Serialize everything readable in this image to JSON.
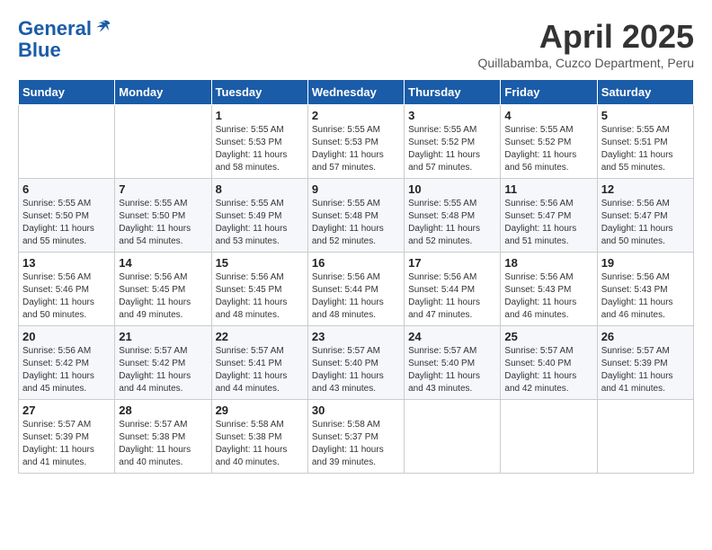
{
  "header": {
    "logo_line1": "General",
    "logo_line2": "Blue",
    "month_title": "April 2025",
    "location": "Quillabamba, Cuzco Department, Peru"
  },
  "days_of_week": [
    "Sunday",
    "Monday",
    "Tuesday",
    "Wednesday",
    "Thursday",
    "Friday",
    "Saturday"
  ],
  "weeks": [
    [
      {
        "day": "",
        "info": ""
      },
      {
        "day": "",
        "info": ""
      },
      {
        "day": "1",
        "info": "Sunrise: 5:55 AM\nSunset: 5:53 PM\nDaylight: 11 hours and 58 minutes."
      },
      {
        "day": "2",
        "info": "Sunrise: 5:55 AM\nSunset: 5:53 PM\nDaylight: 11 hours and 57 minutes."
      },
      {
        "day": "3",
        "info": "Sunrise: 5:55 AM\nSunset: 5:52 PM\nDaylight: 11 hours and 57 minutes."
      },
      {
        "day": "4",
        "info": "Sunrise: 5:55 AM\nSunset: 5:52 PM\nDaylight: 11 hours and 56 minutes."
      },
      {
        "day": "5",
        "info": "Sunrise: 5:55 AM\nSunset: 5:51 PM\nDaylight: 11 hours and 55 minutes."
      }
    ],
    [
      {
        "day": "6",
        "info": "Sunrise: 5:55 AM\nSunset: 5:50 PM\nDaylight: 11 hours and 55 minutes."
      },
      {
        "day": "7",
        "info": "Sunrise: 5:55 AM\nSunset: 5:50 PM\nDaylight: 11 hours and 54 minutes."
      },
      {
        "day": "8",
        "info": "Sunrise: 5:55 AM\nSunset: 5:49 PM\nDaylight: 11 hours and 53 minutes."
      },
      {
        "day": "9",
        "info": "Sunrise: 5:55 AM\nSunset: 5:48 PM\nDaylight: 11 hours and 52 minutes."
      },
      {
        "day": "10",
        "info": "Sunrise: 5:55 AM\nSunset: 5:48 PM\nDaylight: 11 hours and 52 minutes."
      },
      {
        "day": "11",
        "info": "Sunrise: 5:56 AM\nSunset: 5:47 PM\nDaylight: 11 hours and 51 minutes."
      },
      {
        "day": "12",
        "info": "Sunrise: 5:56 AM\nSunset: 5:47 PM\nDaylight: 11 hours and 50 minutes."
      }
    ],
    [
      {
        "day": "13",
        "info": "Sunrise: 5:56 AM\nSunset: 5:46 PM\nDaylight: 11 hours and 50 minutes."
      },
      {
        "day": "14",
        "info": "Sunrise: 5:56 AM\nSunset: 5:45 PM\nDaylight: 11 hours and 49 minutes."
      },
      {
        "day": "15",
        "info": "Sunrise: 5:56 AM\nSunset: 5:45 PM\nDaylight: 11 hours and 48 minutes."
      },
      {
        "day": "16",
        "info": "Sunrise: 5:56 AM\nSunset: 5:44 PM\nDaylight: 11 hours and 48 minutes."
      },
      {
        "day": "17",
        "info": "Sunrise: 5:56 AM\nSunset: 5:44 PM\nDaylight: 11 hours and 47 minutes."
      },
      {
        "day": "18",
        "info": "Sunrise: 5:56 AM\nSunset: 5:43 PM\nDaylight: 11 hours and 46 minutes."
      },
      {
        "day": "19",
        "info": "Sunrise: 5:56 AM\nSunset: 5:43 PM\nDaylight: 11 hours and 46 minutes."
      }
    ],
    [
      {
        "day": "20",
        "info": "Sunrise: 5:56 AM\nSunset: 5:42 PM\nDaylight: 11 hours and 45 minutes."
      },
      {
        "day": "21",
        "info": "Sunrise: 5:57 AM\nSunset: 5:42 PM\nDaylight: 11 hours and 44 minutes."
      },
      {
        "day": "22",
        "info": "Sunrise: 5:57 AM\nSunset: 5:41 PM\nDaylight: 11 hours and 44 minutes."
      },
      {
        "day": "23",
        "info": "Sunrise: 5:57 AM\nSunset: 5:40 PM\nDaylight: 11 hours and 43 minutes."
      },
      {
        "day": "24",
        "info": "Sunrise: 5:57 AM\nSunset: 5:40 PM\nDaylight: 11 hours and 43 minutes."
      },
      {
        "day": "25",
        "info": "Sunrise: 5:57 AM\nSunset: 5:40 PM\nDaylight: 11 hours and 42 minutes."
      },
      {
        "day": "26",
        "info": "Sunrise: 5:57 AM\nSunset: 5:39 PM\nDaylight: 11 hours and 41 minutes."
      }
    ],
    [
      {
        "day": "27",
        "info": "Sunrise: 5:57 AM\nSunset: 5:39 PM\nDaylight: 11 hours and 41 minutes."
      },
      {
        "day": "28",
        "info": "Sunrise: 5:57 AM\nSunset: 5:38 PM\nDaylight: 11 hours and 40 minutes."
      },
      {
        "day": "29",
        "info": "Sunrise: 5:58 AM\nSunset: 5:38 PM\nDaylight: 11 hours and 40 minutes."
      },
      {
        "day": "30",
        "info": "Sunrise: 5:58 AM\nSunset: 5:37 PM\nDaylight: 11 hours and 39 minutes."
      },
      {
        "day": "",
        "info": ""
      },
      {
        "day": "",
        "info": ""
      },
      {
        "day": "",
        "info": ""
      }
    ]
  ]
}
